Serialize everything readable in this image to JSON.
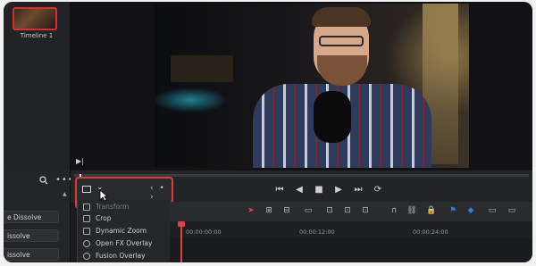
{
  "media_pool": {
    "thumbnail_label": "Timeline 1"
  },
  "left_panel": {
    "transitions": [
      "e Dissolve",
      "issolve",
      "issolve"
    ]
  },
  "effects_menu": {
    "items": [
      {
        "label": "Transform",
        "icon": "transform-icon",
        "state": "selected"
      },
      {
        "label": "Crop",
        "icon": "crop-icon"
      },
      {
        "label": "Dynamic Zoom",
        "icon": "dynamic-zoom-icon"
      },
      {
        "label": "Open FX Overlay",
        "icon": "openfx-overlay-icon"
      },
      {
        "label": "Fusion Overlay",
        "icon": "fusion-overlay-icon"
      }
    ]
  },
  "transport": {
    "buttons": [
      "skip-to-start-icon",
      "step-back-icon",
      "stop-icon",
      "play-icon",
      "skip-to-end-icon",
      "loop-icon"
    ]
  },
  "timeline": {
    "timecodes": [
      "00:00:00:00",
      "00:00:12:00",
      "00:00:24:00"
    ]
  },
  "colors": {
    "highlight_border": "#e0393a",
    "playhead": "#e04040",
    "flag_blue": "#2d7be6"
  }
}
